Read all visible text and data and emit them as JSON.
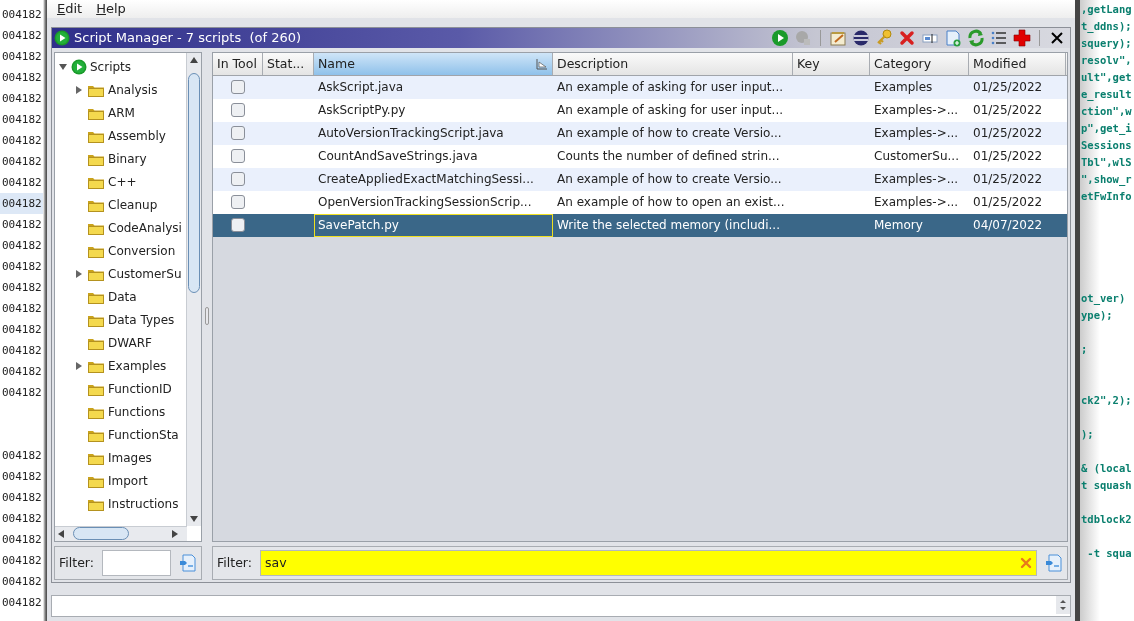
{
  "listing_gutter": {
    "blocks": [
      {
        "lines": [
          {
            "text": "004182",
            "selected": false
          },
          {
            "text": "004182",
            "selected": false
          },
          {
            "text": "004182",
            "selected": false
          },
          {
            "text": "004182",
            "selected": false
          },
          {
            "text": "004182",
            "selected": false
          },
          {
            "text": "004182",
            "selected": false
          },
          {
            "text": "004182",
            "selected": false
          },
          {
            "text": "004182",
            "selected": false
          },
          {
            "text": "004182",
            "selected": false
          },
          {
            "text": "004182",
            "selected": true
          },
          {
            "text": "004182",
            "selected": false
          },
          {
            "text": "004182",
            "selected": false
          },
          {
            "text": "004182",
            "selected": false
          },
          {
            "text": "004182",
            "selected": false
          },
          {
            "text": "004182",
            "selected": false
          },
          {
            "text": "004182",
            "selected": false
          },
          {
            "text": "004182",
            "selected": false
          },
          {
            "text": "004182",
            "selected": false
          },
          {
            "text": "004182",
            "selected": false
          }
        ]
      },
      {
        "lines": [
          {
            "text": "004182",
            "selected": false
          },
          {
            "text": "004182",
            "selected": false
          },
          {
            "text": "004182",
            "selected": false
          },
          {
            "text": "004182",
            "selected": false
          },
          {
            "text": "004182",
            "selected": false
          },
          {
            "text": "004182",
            "selected": false
          },
          {
            "text": "004182",
            "selected": false
          },
          {
            "text": "004182",
            "selected": false
          }
        ]
      }
    ]
  },
  "menu": [
    "Edit",
    "Help"
  ],
  "script_manager": {
    "title": "Script Manager - 7 scripts  (of 260)",
    "tree": {
      "label": "Scripts",
      "expanded": true,
      "children": [
        {
          "label": "Analysis",
          "kind": "group",
          "expanded": false
        },
        {
          "label": "ARM",
          "kind": "leaf"
        },
        {
          "label": "Assembly",
          "kind": "leaf"
        },
        {
          "label": "Binary",
          "kind": "leaf"
        },
        {
          "label": "C++",
          "kind": "leaf"
        },
        {
          "label": "Cleanup",
          "kind": "leaf"
        },
        {
          "label": "CodeAnalysi",
          "kind": "leaf"
        },
        {
          "label": "Conversion",
          "kind": "leaf"
        },
        {
          "label": "CustomerSu",
          "kind": "group",
          "expanded": false
        },
        {
          "label": "Data",
          "kind": "leaf"
        },
        {
          "label": "Data Types",
          "kind": "leaf"
        },
        {
          "label": "DWARF",
          "kind": "leaf"
        },
        {
          "label": "Examples",
          "kind": "group",
          "expanded": false
        },
        {
          "label": "FunctionID",
          "kind": "leaf"
        },
        {
          "label": "Functions",
          "kind": "leaf"
        },
        {
          "label": "FunctionSta",
          "kind": "leaf"
        },
        {
          "label": "Images",
          "kind": "leaf"
        },
        {
          "label": "Import",
          "kind": "leaf"
        },
        {
          "label": "Instructions",
          "kind": "leaf"
        }
      ]
    },
    "tree_filter": {
      "label": "Filter:"
    },
    "table": {
      "columns": [
        {
          "label": "In Tool",
          "sorted": false
        },
        {
          "label": "Stat...",
          "sorted": false
        },
        {
          "label": "Name",
          "sorted": true
        },
        {
          "label": "Description",
          "sorted": false
        },
        {
          "label": "Key",
          "sorted": false
        },
        {
          "label": "Category",
          "sorted": false
        },
        {
          "label": "Modified",
          "sorted": false
        }
      ],
      "rows": [
        {
          "in_tool": false,
          "name": "AskScript.java",
          "description": "An example of asking for user input...",
          "category": "Examples",
          "modified": "01/25/2022",
          "selected": false
        },
        {
          "in_tool": false,
          "name": "AskScriptPy.py",
          "description": "An example of asking for user input...",
          "category": "Examples->...",
          "modified": "01/25/2022",
          "selected": false
        },
        {
          "in_tool": false,
          "name": "AutoVersionTrackingScript.java",
          "description": "An example of how to create Versio...",
          "category": "Examples->...",
          "modified": "01/25/2022",
          "selected": false
        },
        {
          "in_tool": false,
          "name": "CountAndSaveStrings.java",
          "description": "Counts the number of defined strin...",
          "category": "CustomerSu...",
          "modified": "01/25/2022",
          "selected": false
        },
        {
          "in_tool": false,
          "name": "CreateAppliedExactMatchingSessi...",
          "description": "An example of how to create Versio...",
          "category": "Examples->...",
          "modified": "01/25/2022",
          "selected": false
        },
        {
          "in_tool": false,
          "name": "OpenVersionTrackingSessionScrip...",
          "description": "An example of how to open an exist...",
          "category": "Examples->...",
          "modified": "01/25/2022",
          "selected": false
        },
        {
          "in_tool": false,
          "name": "SavePatch.py",
          "description": "Write the selected memory (includi...",
          "category": "Memory",
          "modified": "04/07/2022",
          "selected": true
        }
      ]
    },
    "table_filter": {
      "label": "Filter:",
      "value": "sav",
      "active": true
    }
  },
  "code_pane": {
    "blocks": [
      {
        "lines": [
          ",getLang",
          "t_ddns);",
          "squery);",
          "resolv\",",
          "ult\",get",
          "e_result",
          "ction\",w",
          "p\",get_i",
          "Sessions",
          "Tbl\",wlS",
          "\",show_r",
          "etFwInfo"
        ]
      },
      {
        "lines": [
          "ot_ver)",
          "ype);"
        ]
      },
      {
        "lines": [
          ";"
        ]
      },
      {
        "lines": [
          "ck2\",2);"
        ]
      },
      {
        "lines": [
          ");"
        ]
      },
      {
        "lines": [
          "& (local",
          "t squash"
        ]
      },
      {
        "lines": [
          "tdblock2"
        ]
      },
      {
        "lines": [
          " -t squa"
        ]
      }
    ]
  }
}
